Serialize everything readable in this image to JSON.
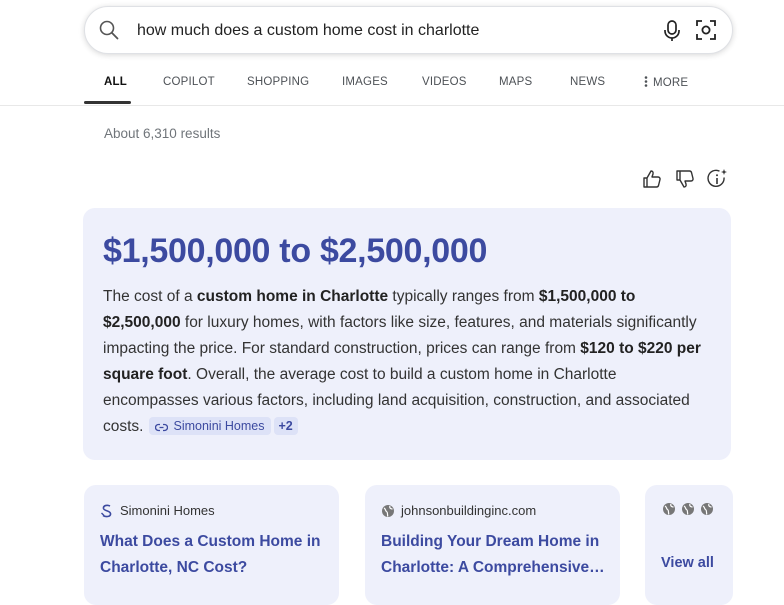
{
  "search": {
    "query": "how much does a custom home cost in charlotte"
  },
  "tabs": [
    {
      "label": "ALL"
    },
    {
      "label": "COPILOT"
    },
    {
      "label": "SHOPPING"
    },
    {
      "label": "IMAGES"
    },
    {
      "label": "VIDEOS"
    },
    {
      "label": "MAPS"
    },
    {
      "label": "NEWS"
    },
    {
      "label": "MORE"
    }
  ],
  "results_count": "About 6,310 results",
  "answer": {
    "title": "$1,500,000 to $2,500,000",
    "body": {
      "t1": "The cost of a ",
      "b1": "custom home in Charlotte",
      "t2": " typically ranges from ",
      "b2": "$1,500,000 to $2,500,000",
      "t3": " for luxury homes, with factors like size, features, and materials significantly impacting the price. For standard construction, prices can range from ",
      "b3": "$120 to $220 per square foot",
      "t4": ". Overall, the average cost to build a custom home in Charlotte encompasses various factors, including land acquisition, construction, and associated costs."
    },
    "source_chip": "Simonini Homes",
    "more_chip": "+2"
  },
  "source_cards": [
    {
      "source": "Simonini Homes",
      "title": "What Does a Custom Home in Charlotte, NC Cost?"
    },
    {
      "source": "johnsonbuildinginc.com",
      "title": "Building Your Dream Home in Charlotte: A Comprehensive…"
    }
  ],
  "view_all": "View all",
  "colors": {
    "accent": "#3c4aa0",
    "card_bg": "#eef0fb",
    "chip_bg": "#dde2f7"
  }
}
